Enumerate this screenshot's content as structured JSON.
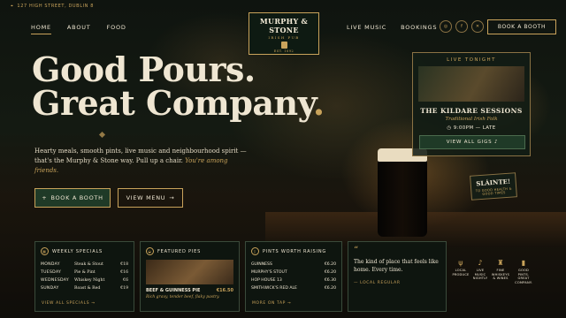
{
  "topbar": {
    "address": "127 HIGH STREET, DUBLIN 8",
    "icon": "map-pin-icon"
  },
  "nav": {
    "left": [
      "HOME",
      "ABOUT",
      "FOOD"
    ],
    "right": [
      "LIVE MUSIC",
      "BOOKINGS"
    ],
    "book": "BOOK A BOOTH",
    "social": [
      "instagram-icon",
      "facebook-icon",
      "twitter-icon"
    ]
  },
  "logo": {
    "name": "MURPHY & STONE",
    "tagline": "IRISH PUB",
    "est": "EST. 1892"
  },
  "hero": {
    "line1": "Good Pours.",
    "line2": "Great Company",
    "dot": ".",
    "intro": "Hearty meals, smooth pints, live music and neighbourhood spirit — that's the Murphy & Stone way. Pull up a chair.",
    "intro_em": "You're among friends.",
    "book_label": "BOOK A BOOTH",
    "menu_label": "VIEW MENU"
  },
  "live": {
    "label": "LIVE TONIGHT",
    "title": "THE KILDARE SESSIONS",
    "subtitle": "Traditional Irish Folk",
    "time": "9:00PM — LATE",
    "button": "VIEW ALL GIGS ♪"
  },
  "slainte": {
    "title": "SLÁINTE!",
    "sub": "TO GOOD HEALTH & GOOD TIMES"
  },
  "specials": {
    "title": "WEEKLY SPECIALS",
    "rows": [
      {
        "day": "MONDAY",
        "item": "Steak & Stout",
        "price": "€18"
      },
      {
        "day": "TUESDAY",
        "item": "Pie & Pint",
        "price": "€16"
      },
      {
        "day": "WEDNESDAY",
        "item": "Whiskey Night",
        "price": "€6"
      },
      {
        "day": "SUNDAY",
        "item": "Roast & Red",
        "price": "€19"
      }
    ],
    "link": "VIEW ALL SPECIALS →"
  },
  "pies": {
    "title": "FEATURED PIES",
    "name": "BEEF & GUINNESS PIE",
    "price": "€16.50",
    "desc": "Rich gravy, tender beef, flaky pastry."
  },
  "pints": {
    "title": "PINTS WORTH RAISING",
    "rows": [
      {
        "name": "GUINNESS",
        "price": "€6.20"
      },
      {
        "name": "MURPHY'S STOUT",
        "price": "€6.20"
      },
      {
        "name": "HOP HOUSE 13",
        "price": "€6.30"
      },
      {
        "name": "SMITHWICK'S RED ALE",
        "price": "€6.20"
      }
    ],
    "link": "MORE ON TAP →"
  },
  "quote": {
    "mark": "“",
    "text": "The kind of place that feels like home. Every time.",
    "author": "— LOCAL REGULAR"
  },
  "features": [
    {
      "icon": "fork-knife-icon",
      "label": "LOCAL PRODUCE"
    },
    {
      "icon": "music-note-icon",
      "label": "LIVE MUSIC NIGHTLY"
    },
    {
      "icon": "glass-icon",
      "label": "FINE WHISKEYS & WINES"
    },
    {
      "icon": "beer-mug-icon",
      "label": "GOOD PINTS. GREAT COMPANY."
    }
  ]
}
